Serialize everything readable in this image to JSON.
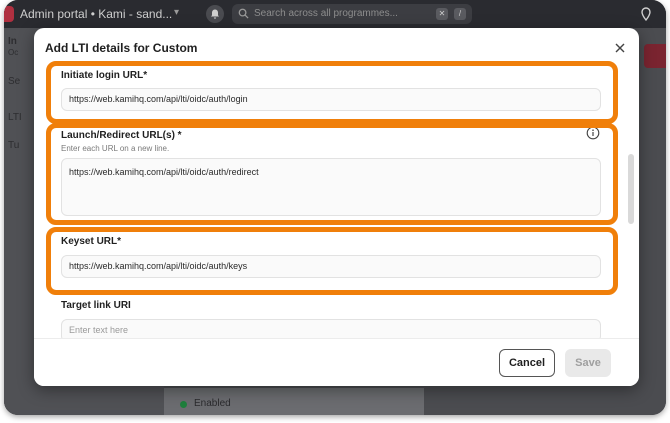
{
  "topbar": {
    "app_title": "Admin portal • Kami - sand...",
    "search_placeholder": "Search across all programmes...",
    "search_key1": "✕",
    "search_key2": "/"
  },
  "background": {
    "sidebar_items": [
      "In",
      "Oc",
      "Se",
      "LTI",
      "Tu"
    ],
    "status_text": "Enabled"
  },
  "modal": {
    "title": "Add LTI details for Custom",
    "fields": {
      "initiate_login": {
        "label": "Initiate login URL*",
        "value": "https://web.kamihq.com/api/lti/oidc/auth/login"
      },
      "launch_redirect": {
        "label": "Launch/Redirect URL(s) *",
        "help": "Enter each URL on a new line.",
        "value": "https://web.kamihq.com/api/lti/oidc/auth/redirect"
      },
      "keyset": {
        "label": "Keyset URL*",
        "value": "https://web.kamihq.com/api/lti/oidc/auth/keys"
      },
      "target_link": {
        "label": "Target link URI",
        "placeholder": "Enter text here"
      }
    },
    "buttons": {
      "cancel": "Cancel",
      "save": "Save"
    }
  },
  "colors": {
    "highlight": "#f07f0a",
    "enabled": "#1e7f3c"
  }
}
